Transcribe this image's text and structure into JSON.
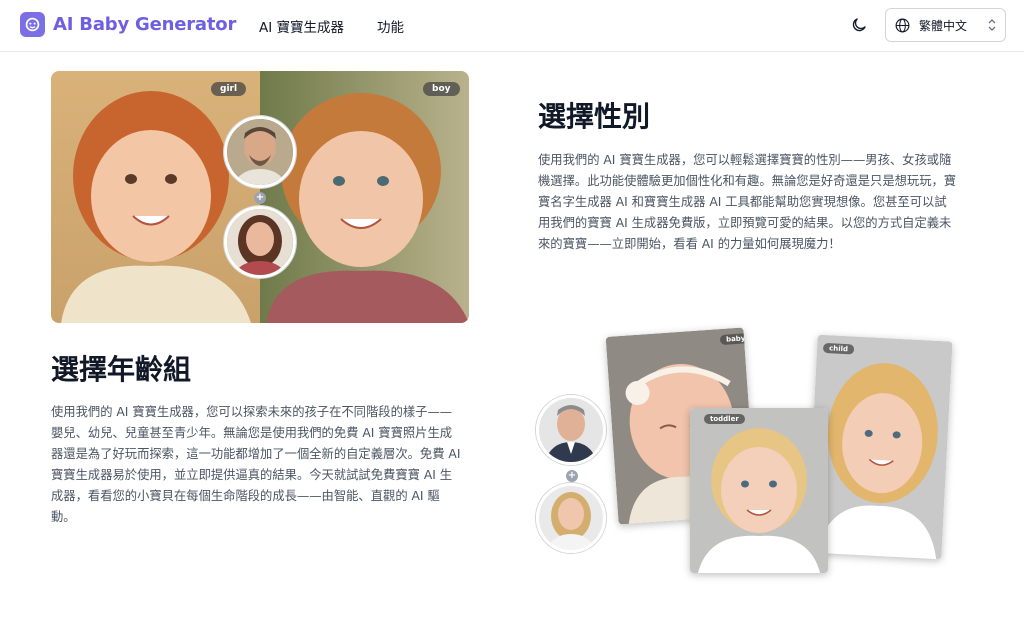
{
  "nav": {
    "logo_text": "AI Baby Generator",
    "links": [
      "AI 寶寶生成器",
      "功能"
    ],
    "language": "繁體中文"
  },
  "section_gender": {
    "title": "選擇性別",
    "body": "使用我們的 AI 寶寶生成器，您可以輕鬆選擇寶寶的性別——男孩、女孩或隨機選擇。此功能使體驗更加個性化和有趣。無論您是好奇還是只是想玩玩，寶寶名字生成器 AI 和寶寶生成器 AI 工具都能幫助您實現想像。您甚至可以試用我們的寶寶 AI 生成器免費版，立即預覽可愛的結果。以您的方式自定義未來的寶寶——立即開始，看看 AI 的力量如何展現魔力！",
    "image_tags": [
      "girl",
      "boy"
    ]
  },
  "section_age": {
    "title": "選擇年齡組",
    "body": "使用我們的 AI 寶寶生成器，您可以探索未來的孩子在不同階段的樣子——嬰兒、幼兒、兒童甚至青少年。無論您是使用我們的免費 AI 寶寶照片生成器還是為了好玩而探索，這一功能都增加了一個全新的自定義層次。免費 AI 寶寶生成器易於使用，並立即提供逼真的結果。今天就試試免費寶寶 AI 生成器，看看您的小寶貝在每個生命階段的成長——由智能、直觀的 AI 驅動。",
    "image_tags": [
      "baby",
      "toddler",
      "child"
    ]
  },
  "colors": {
    "brand": "#6d5fe0",
    "text": "#111827",
    "muted": "#4b5563"
  }
}
